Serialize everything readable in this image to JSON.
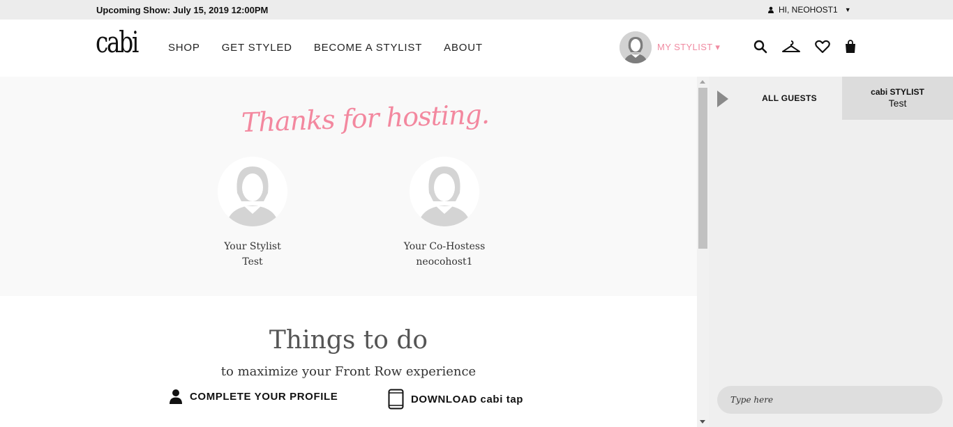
{
  "topbar": {
    "upcoming_show": "Upcoming Show: July 15, 2019 12:00PM",
    "user_greeting": "HI, NEOHOST1"
  },
  "header": {
    "logo": "cabi",
    "nav": [
      "SHOP",
      "GET STYLED",
      "BECOME A STYLIST",
      "ABOUT"
    ],
    "my_stylist_label": "MY STYLIST",
    "icons": [
      "search-icon",
      "hanger-icon",
      "heart-icon",
      "shopping-bag-icon"
    ]
  },
  "hero": {
    "headline": "Thanks for hosting.",
    "stylist": {
      "role": "Your Stylist",
      "name": "Test"
    },
    "cohostess": {
      "role": "Your Co-Hostess",
      "name": "neocohost1"
    }
  },
  "todo": {
    "title": "Things to do",
    "subtitle": "to maximize your Front Row experience",
    "items": [
      {
        "icon": "user-icon",
        "label": "COMPLETE YOUR PROFILE"
      },
      {
        "icon": "phone-icon",
        "label": "DOWNLOAD cabi tap"
      }
    ]
  },
  "chat": {
    "tab_all": "ALL GUESTS",
    "tab_stylist_title": "cabi STYLIST",
    "tab_stylist_name": "Test",
    "input_placeholder": "Type here"
  },
  "colors": {
    "accent_pink": "#f3889f",
    "topbar_bg": "#ececec",
    "hero_bg": "#f9f9f9",
    "chat_bg": "#efefef"
  }
}
